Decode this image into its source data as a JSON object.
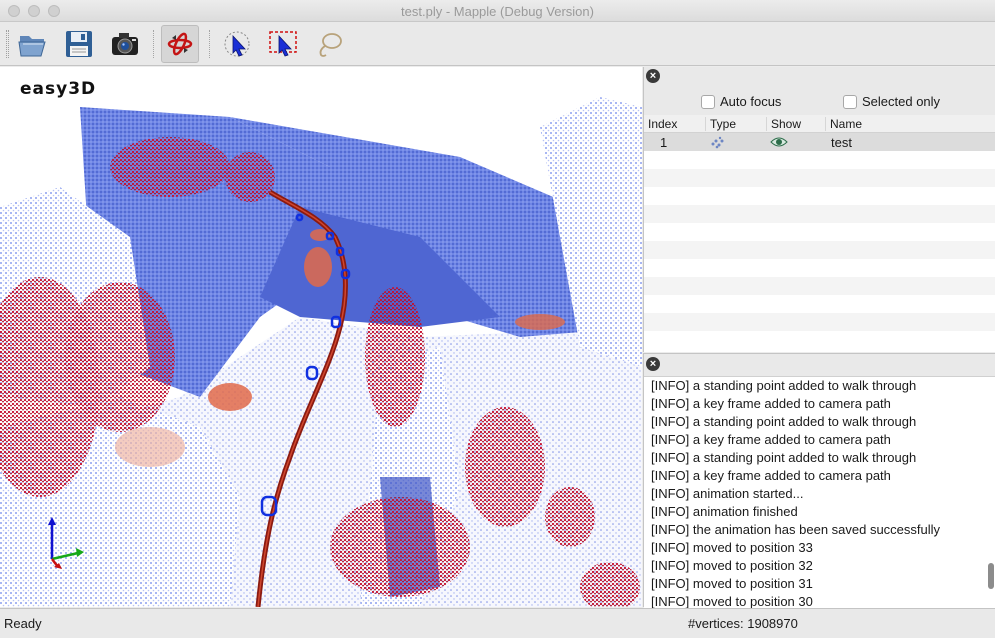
{
  "window": {
    "title": "test.ply - Mapple (Debug Version)"
  },
  "toolbar": {
    "buttons": [
      {
        "name": "open",
        "icon": "folder-open-icon"
      },
      {
        "name": "save",
        "icon": "floppy-disk-icon"
      },
      {
        "name": "snapshot",
        "icon": "camera-icon"
      },
      {
        "name": "rotate",
        "icon": "rotate-3d-icon"
      },
      {
        "name": "select-click",
        "icon": "select-click-icon"
      },
      {
        "name": "select-rect",
        "icon": "select-rect-icon"
      },
      {
        "name": "select-lasso",
        "icon": "lasso-icon"
      }
    ]
  },
  "viewer": {
    "logo": "easy3D"
  },
  "models_panel": {
    "auto_focus_label": "Auto focus",
    "selected_only_label": "Selected only",
    "columns": [
      "Index",
      "Type",
      "Show",
      "Name"
    ],
    "rows": [
      {
        "index": "1",
        "type_icon": "point-cloud-icon",
        "show_icon": "eye-icon",
        "name": "test"
      }
    ]
  },
  "log_panel": {
    "lines": [
      "[INFO] a standing point added to walk through",
      "[INFO] a key frame added to camera path",
      "[INFO] a standing point added to walk through",
      "[INFO] a key frame added to camera path",
      "[INFO] a standing point added to walk through",
      "[INFO] a key frame added to camera path",
      "[INFO] animation started...",
      "[INFO] animation finished",
      "[INFO] the animation has been saved successfully",
      "[INFO] moved to position 33",
      "[INFO] moved to position 32",
      "[INFO] moved to position 31",
      "[INFO] moved to position 30"
    ]
  },
  "statusbar": {
    "status": "Ready",
    "vertices": "#vertices: 1908970"
  },
  "colors": {
    "points_blue": "#4a66d8",
    "points_red": "#c8102e",
    "path_red": "#8b1a10",
    "keyframe_blue": "#1030e0"
  }
}
